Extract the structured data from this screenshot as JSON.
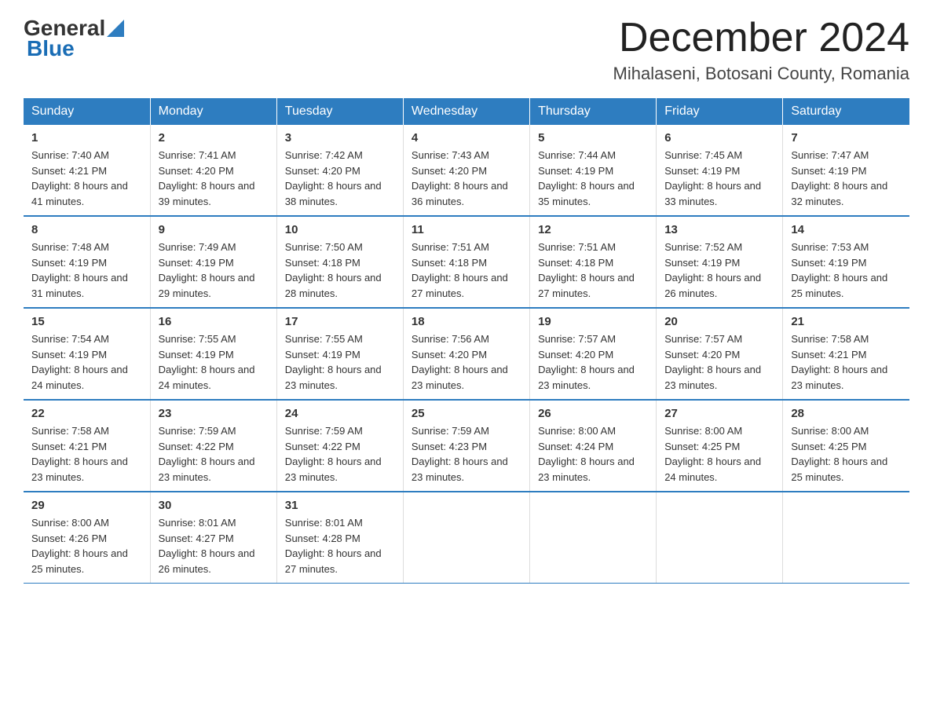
{
  "header": {
    "logo_general": "General",
    "logo_blue": "Blue",
    "month_title": "December 2024",
    "location": "Mihalaseni, Botosani County, Romania"
  },
  "days_of_week": [
    "Sunday",
    "Monday",
    "Tuesday",
    "Wednesday",
    "Thursday",
    "Friday",
    "Saturday"
  ],
  "weeks": [
    [
      {
        "day": "1",
        "sunrise": "7:40 AM",
        "sunset": "4:21 PM",
        "daylight": "8 hours and 41 minutes."
      },
      {
        "day": "2",
        "sunrise": "7:41 AM",
        "sunset": "4:20 PM",
        "daylight": "8 hours and 39 minutes."
      },
      {
        "day": "3",
        "sunrise": "7:42 AM",
        "sunset": "4:20 PM",
        "daylight": "8 hours and 38 minutes."
      },
      {
        "day": "4",
        "sunrise": "7:43 AM",
        "sunset": "4:20 PM",
        "daylight": "8 hours and 36 minutes."
      },
      {
        "day": "5",
        "sunrise": "7:44 AM",
        "sunset": "4:19 PM",
        "daylight": "8 hours and 35 minutes."
      },
      {
        "day": "6",
        "sunrise": "7:45 AM",
        "sunset": "4:19 PM",
        "daylight": "8 hours and 33 minutes."
      },
      {
        "day": "7",
        "sunrise": "7:47 AM",
        "sunset": "4:19 PM",
        "daylight": "8 hours and 32 minutes."
      }
    ],
    [
      {
        "day": "8",
        "sunrise": "7:48 AM",
        "sunset": "4:19 PM",
        "daylight": "8 hours and 31 minutes."
      },
      {
        "day": "9",
        "sunrise": "7:49 AM",
        "sunset": "4:19 PM",
        "daylight": "8 hours and 29 minutes."
      },
      {
        "day": "10",
        "sunrise": "7:50 AM",
        "sunset": "4:18 PM",
        "daylight": "8 hours and 28 minutes."
      },
      {
        "day": "11",
        "sunrise": "7:51 AM",
        "sunset": "4:18 PM",
        "daylight": "8 hours and 27 minutes."
      },
      {
        "day": "12",
        "sunrise": "7:51 AM",
        "sunset": "4:18 PM",
        "daylight": "8 hours and 27 minutes."
      },
      {
        "day": "13",
        "sunrise": "7:52 AM",
        "sunset": "4:19 PM",
        "daylight": "8 hours and 26 minutes."
      },
      {
        "day": "14",
        "sunrise": "7:53 AM",
        "sunset": "4:19 PM",
        "daylight": "8 hours and 25 minutes."
      }
    ],
    [
      {
        "day": "15",
        "sunrise": "7:54 AM",
        "sunset": "4:19 PM",
        "daylight": "8 hours and 24 minutes."
      },
      {
        "day": "16",
        "sunrise": "7:55 AM",
        "sunset": "4:19 PM",
        "daylight": "8 hours and 24 minutes."
      },
      {
        "day": "17",
        "sunrise": "7:55 AM",
        "sunset": "4:19 PM",
        "daylight": "8 hours and 23 minutes."
      },
      {
        "day": "18",
        "sunrise": "7:56 AM",
        "sunset": "4:20 PM",
        "daylight": "8 hours and 23 minutes."
      },
      {
        "day": "19",
        "sunrise": "7:57 AM",
        "sunset": "4:20 PM",
        "daylight": "8 hours and 23 minutes."
      },
      {
        "day": "20",
        "sunrise": "7:57 AM",
        "sunset": "4:20 PM",
        "daylight": "8 hours and 23 minutes."
      },
      {
        "day": "21",
        "sunrise": "7:58 AM",
        "sunset": "4:21 PM",
        "daylight": "8 hours and 23 minutes."
      }
    ],
    [
      {
        "day": "22",
        "sunrise": "7:58 AM",
        "sunset": "4:21 PM",
        "daylight": "8 hours and 23 minutes."
      },
      {
        "day": "23",
        "sunrise": "7:59 AM",
        "sunset": "4:22 PM",
        "daylight": "8 hours and 23 minutes."
      },
      {
        "day": "24",
        "sunrise": "7:59 AM",
        "sunset": "4:22 PM",
        "daylight": "8 hours and 23 minutes."
      },
      {
        "day": "25",
        "sunrise": "7:59 AM",
        "sunset": "4:23 PM",
        "daylight": "8 hours and 23 minutes."
      },
      {
        "day": "26",
        "sunrise": "8:00 AM",
        "sunset": "4:24 PM",
        "daylight": "8 hours and 23 minutes."
      },
      {
        "day": "27",
        "sunrise": "8:00 AM",
        "sunset": "4:25 PM",
        "daylight": "8 hours and 24 minutes."
      },
      {
        "day": "28",
        "sunrise": "8:00 AM",
        "sunset": "4:25 PM",
        "daylight": "8 hours and 25 minutes."
      }
    ],
    [
      {
        "day": "29",
        "sunrise": "8:00 AM",
        "sunset": "4:26 PM",
        "daylight": "8 hours and 25 minutes."
      },
      {
        "day": "30",
        "sunrise": "8:01 AM",
        "sunset": "4:27 PM",
        "daylight": "8 hours and 26 minutes."
      },
      {
        "day": "31",
        "sunrise": "8:01 AM",
        "sunset": "4:28 PM",
        "daylight": "8 hours and 27 minutes."
      },
      null,
      null,
      null,
      null
    ]
  ]
}
